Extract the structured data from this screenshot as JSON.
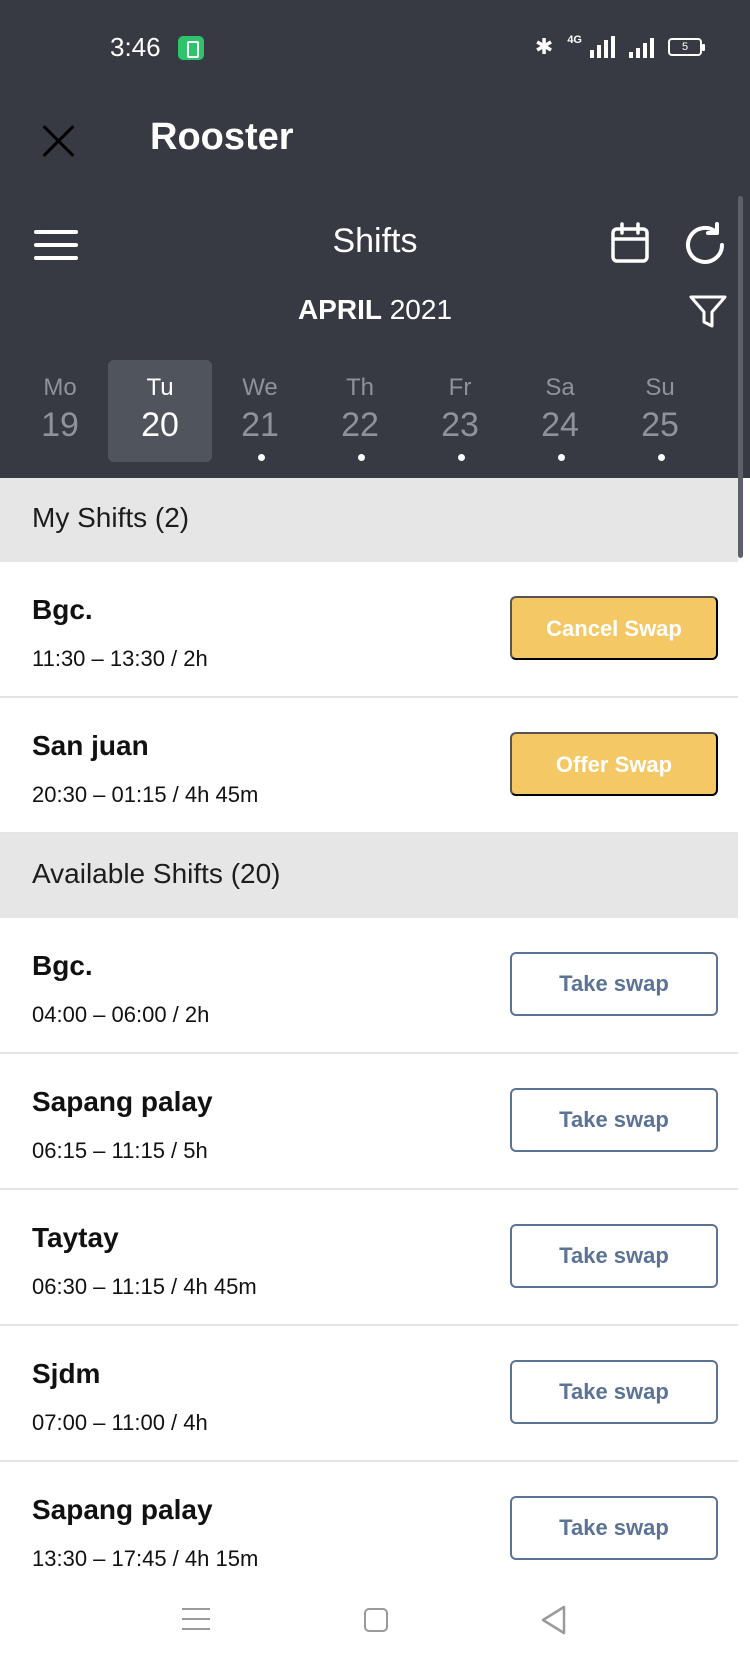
{
  "status_bar": {
    "time": "3:46",
    "network": "4G",
    "battery": "5"
  },
  "app_bar": {
    "title": "Rooster"
  },
  "header": {
    "title": "Shifts",
    "month": "APRIL",
    "year": "2021"
  },
  "days": [
    {
      "name": "Mo",
      "date": "19",
      "selected": false,
      "has_shifts": false
    },
    {
      "name": "Tu",
      "date": "20",
      "selected": true,
      "has_shifts": false
    },
    {
      "name": "We",
      "date": "21",
      "selected": false,
      "has_shifts": true
    },
    {
      "name": "Th",
      "date": "22",
      "selected": false,
      "has_shifts": true
    },
    {
      "name": "Fr",
      "date": "23",
      "selected": false,
      "has_shifts": true
    },
    {
      "name": "Sa",
      "date": "24",
      "selected": false,
      "has_shifts": true
    },
    {
      "name": "Su",
      "date": "25",
      "selected": false,
      "has_shifts": true
    }
  ],
  "my_shifts": {
    "header": "My Shifts (2)",
    "items": [
      {
        "location": "Bgc.",
        "time": "11:30 – 13:30 / 2h",
        "action": "Cancel Swap"
      },
      {
        "location": "San juan",
        "time": "20:30 – 01:15 / 4h 45m",
        "action": "Offer Swap"
      }
    ]
  },
  "available_shifts": {
    "header": "Available Shifts (20)",
    "items": [
      {
        "location": "Bgc.",
        "time": "04:00 – 06:00 / 2h",
        "action": "Take swap"
      },
      {
        "location": "Sapang palay",
        "time": "06:15 – 11:15 / 5h",
        "action": "Take swap"
      },
      {
        "location": "Taytay",
        "time": "06:30 – 11:15 / 4h 45m",
        "action": "Take swap"
      },
      {
        "location": "Sjdm",
        "time": "07:00 – 11:00 / 4h",
        "action": "Take swap"
      },
      {
        "location": "Sapang palay",
        "time": "13:30 – 17:45 / 4h 15m",
        "action": "Take swap"
      }
    ]
  },
  "colors": {
    "header_bg": "#373a42",
    "selected_day_bg": "#50545d",
    "section_bg": "#e6e6e6",
    "yellow_button": "#f3c865",
    "outline_button": "#5c7398"
  },
  "icons": {
    "close": "close-icon",
    "menu": "menu-icon",
    "calendar": "calendar-icon",
    "refresh": "refresh-icon",
    "filter": "filter-icon"
  }
}
